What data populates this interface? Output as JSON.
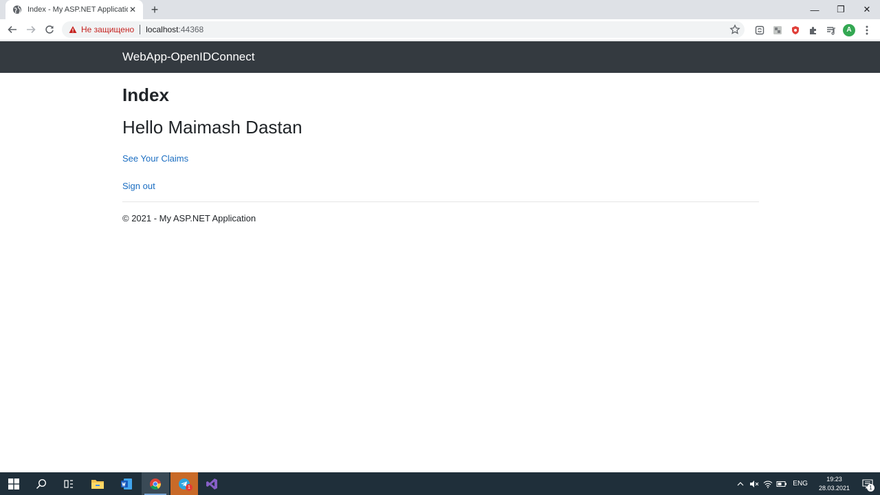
{
  "browser": {
    "tab_title": "Index - My ASP.NET Application",
    "tab_close": "✕",
    "new_tab": "+",
    "window_controls": {
      "minimize": "—",
      "restore": "❐",
      "close": "✕"
    },
    "omnibox": {
      "security_text": "Не защищено",
      "host": "localhost",
      "port": ":44368"
    },
    "profile_initial": "A"
  },
  "page": {
    "brand": "WebApp-OpenIDConnect",
    "heading": "Index",
    "greeting": "Hello Maimash Dastan",
    "links": {
      "claims": "See Your Claims",
      "sign_out": "Sign out"
    },
    "footer": "© 2021 - My ASP.NET Application"
  },
  "taskbar": {
    "telegram_badge": "1",
    "language": "ENG",
    "time": "19:23",
    "date": "28.03.2021",
    "notifications_badge": "1"
  },
  "colors": {
    "navbar": "#343a40",
    "link": "#1b6ec2",
    "warning": "#c5221f",
    "taskbar": "#1f2f3a"
  }
}
